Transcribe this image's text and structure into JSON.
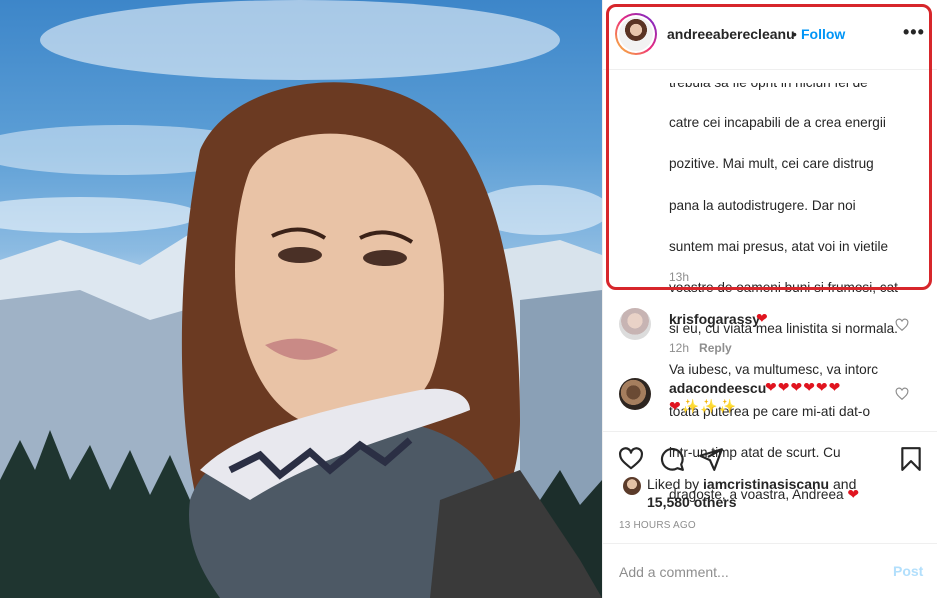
{
  "post": {
    "username": "andreeaberecleanu",
    "separator": "•",
    "follow_label": "Follow",
    "more_label": "•••",
    "caption_cut_line": "trebuia sa fie oprit in niciun fel de",
    "caption_lines": [
      "catre cei incapabili de a crea energii",
      "pozitive. Mai mult, cei care distrug",
      "pana la autodistrugere. Dar noi",
      "suntem mai presus, atat voi in vietile",
      "voastre de oameni buni si frumosi, cat",
      "si eu, cu viata mea linistita si normala.",
      "Va iubesc, va multumesc, va intorc",
      "toata puterea pe care mi-ati dat-o",
      "intr-un timp atat de scurt. Cu",
      "dragoste, a voastra, Andreea"
    ],
    "caption_heart": "❤",
    "caption_time": "13h"
  },
  "comments": [
    {
      "username": "krisfogarassy",
      "hearts": "❤",
      "time": "12h",
      "reply_label": "Reply"
    },
    {
      "username": "adacondeescu",
      "hearts_line1": "❤❤❤❤❤❤",
      "hearts_line2": "❤✨✨✨"
    }
  ],
  "likes": {
    "prefix": "Liked by ",
    "user": "iamcristinasiscanu",
    "joiner": " and",
    "others": "15,580 others"
  },
  "timestamp": "13 HOURS AGO",
  "add_comment": {
    "placeholder": "Add a comment...",
    "post_label": "Post"
  },
  "colors": {
    "accent": "#0095f6",
    "highlight_box": "#d7262b",
    "heart": "#e0141f",
    "muted": "#8e8e8e",
    "post_disabled": "#b2dffc"
  },
  "icons": [
    "heart-icon",
    "comment-icon",
    "share-icon",
    "bookmark-icon",
    "more-icon"
  ]
}
